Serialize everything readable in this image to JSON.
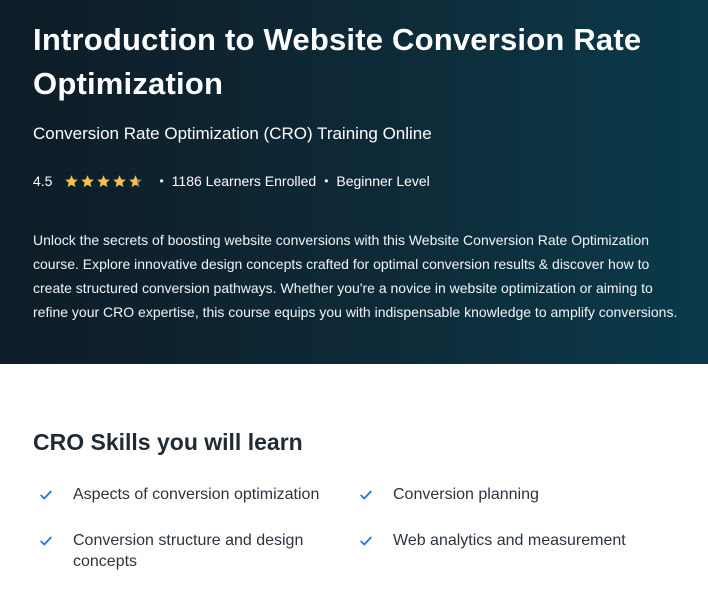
{
  "hero": {
    "title": "Introduction to Website Conversion Rate Optimization",
    "subtitle": "Conversion Rate Optimization (CRO) Training Online",
    "rating": "4.5",
    "rating_value": 4.5,
    "rating_max": 5,
    "learners": "1186 Learners Enrolled",
    "level": "Beginner Level",
    "separator": "•",
    "description": "Unlock the secrets of boosting website conversions with this Website Conversion Rate Optimization course. Explore innovative design concepts crafted for optimal conversion results & discover how to create structured conversion pathways. Whether you're a novice in website optimization or aiming to refine your CRO expertise, this course equips you with indispensable knowledge to amplify conversions."
  },
  "skills": {
    "title": "CRO Skills you will learn",
    "items": [
      {
        "label": "Aspects of conversion optimization",
        "icon": "check-icon"
      },
      {
        "label": "Conversion planning",
        "icon": "check-icon"
      },
      {
        "label": "Conversion structure and design concepts",
        "icon": "check-icon"
      },
      {
        "label": "Web analytics and measurement",
        "icon": "check-icon"
      }
    ]
  },
  "colors": {
    "hero_bg_start": "#0e1c27",
    "hero_bg_end": "#0a3a4a",
    "star": "#f4c150",
    "check": "#1a73e8",
    "heading": "#1f2a33"
  }
}
